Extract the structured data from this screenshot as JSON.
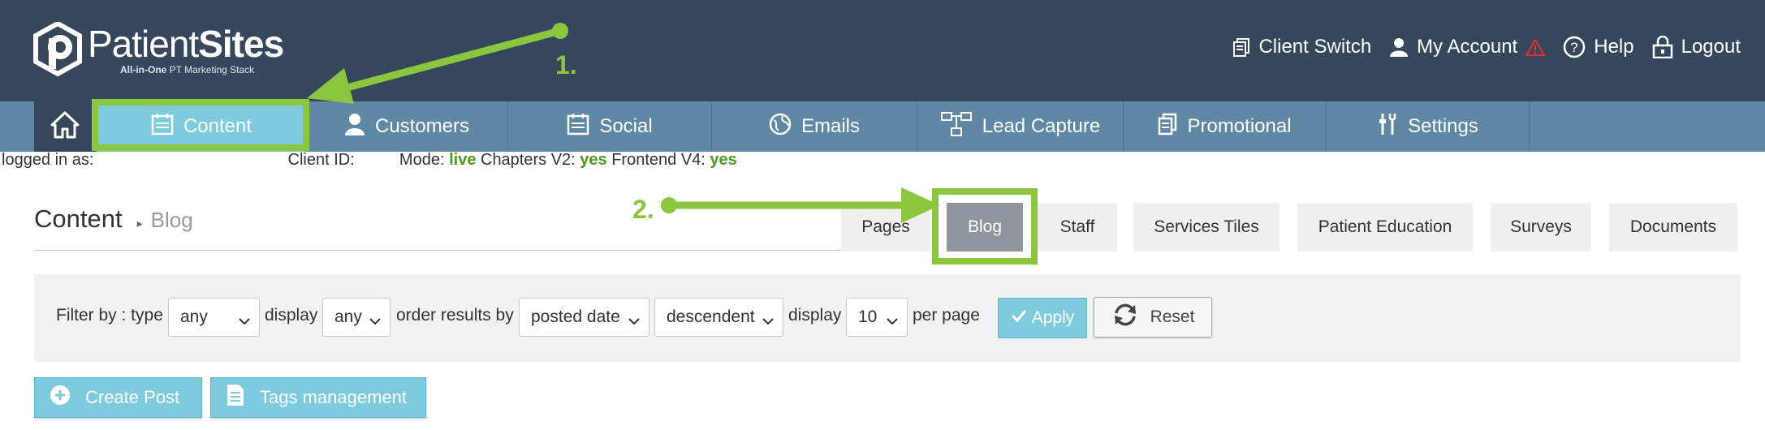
{
  "header": {
    "brand_light": "Patient",
    "brand_bold": "Sites",
    "tagline_bold": "All-in-One",
    "tagline_rest": " PT Marketing Stack",
    "links": [
      {
        "label": "Client Switch",
        "icon": "clipboard-icon"
      },
      {
        "label": "My Account",
        "icon": "user-icon",
        "warning_icon": "warning-icon"
      },
      {
        "label": "Help",
        "icon": "question-circle-icon"
      },
      {
        "label": "Logout",
        "icon": "lock-icon"
      }
    ]
  },
  "nav": {
    "home_icon": "home-icon",
    "items": [
      {
        "label": "Content",
        "icon": "calendar-icon",
        "active": true
      },
      {
        "label": "Customers",
        "icon": "person-icon"
      },
      {
        "label": "Social",
        "icon": "calendar-icon"
      },
      {
        "label": "Emails",
        "icon": "globe-icon"
      },
      {
        "label": "Lead Capture",
        "icon": "sitemap-icon"
      },
      {
        "label": "Promotional",
        "icon": "copy-icon"
      },
      {
        "label": "Settings",
        "icon": "tools-icon"
      }
    ]
  },
  "info": {
    "logged_in": "logged in as:",
    "client_id": "Client ID:",
    "mode_label": "Mode: ",
    "mode_value": "live",
    "chapters_label": " Chapters V2: ",
    "chapters_value": "yes",
    "frontend_label": " Frontend V4: ",
    "frontend_value": "yes"
  },
  "page": {
    "title": "Content",
    "breadcrumb_sep": "▸",
    "subtitle": "Blog"
  },
  "tabs": [
    {
      "label": "Pages"
    },
    {
      "label": "Blog",
      "active": true
    },
    {
      "label": "Staff"
    },
    {
      "label": "Services Tiles"
    },
    {
      "label": "Patient Education"
    },
    {
      "label": "Surveys"
    },
    {
      "label": "Documents"
    }
  ],
  "filter": {
    "filter_by_label": "Filter by : type",
    "type_value": "any",
    "display_label": "display",
    "display_value": "any",
    "order_label": "order results by",
    "order_value": "posted date",
    "direction_value": "descendent",
    "display2_label": "display",
    "per_page_value": "10",
    "per_page_label": "per page",
    "apply_label": "Apply",
    "reset_label": "Reset"
  },
  "actions": {
    "create_post_label": "Create Post",
    "tags_label": "Tags management"
  },
  "annotations": {
    "step1": "1.",
    "step2": "2."
  },
  "colors": {
    "header_bg": "#36475c",
    "nav_bg": "#5f88a4",
    "accent": "#7ecbdd",
    "highlight": "#8cc63f",
    "status_green": "#4f9b22",
    "warning_red": "#e03030"
  }
}
